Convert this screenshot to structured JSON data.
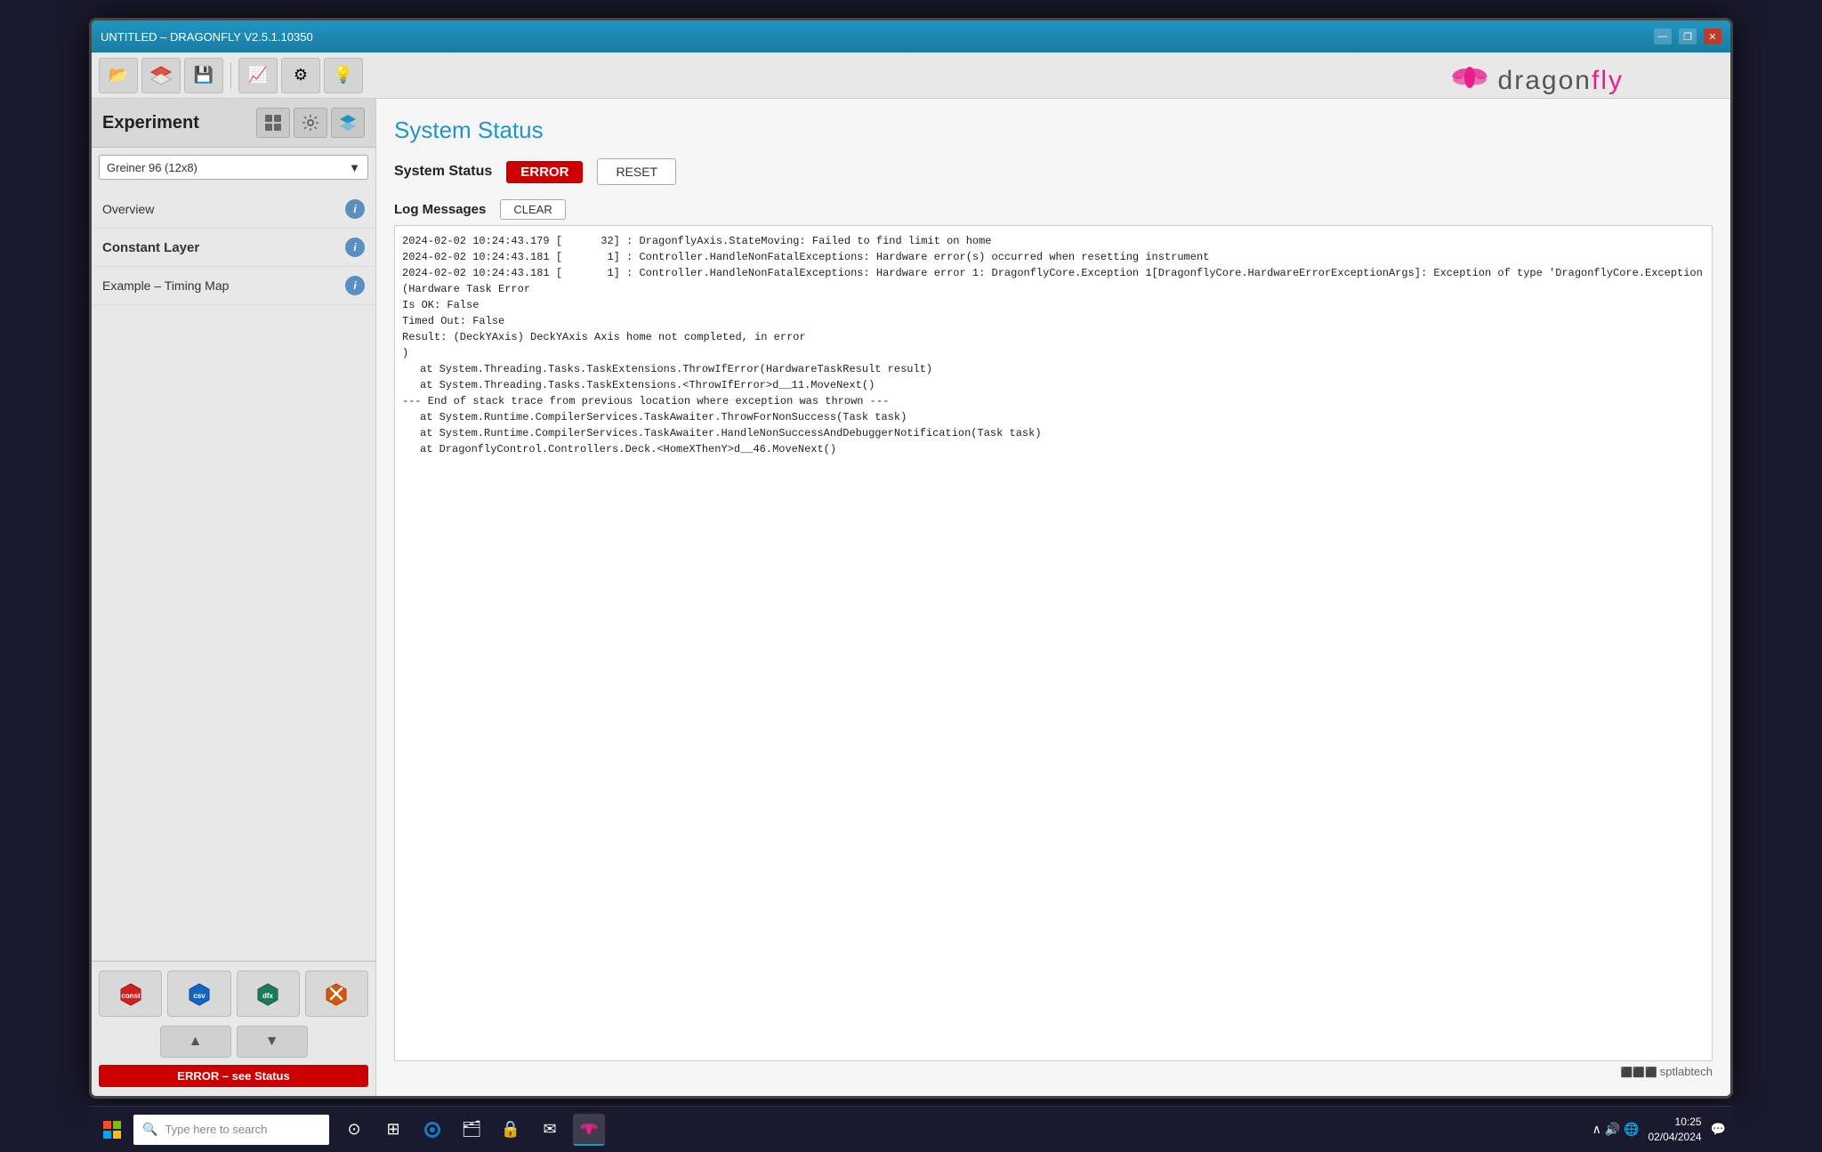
{
  "titleBar": {
    "title": "UNTITLED – DRAGONFLY V2.5.1.10350",
    "controls": [
      "—",
      "❐",
      "✕"
    ]
  },
  "toolbar": {
    "buttons": [
      {
        "name": "open",
        "icon": "📂"
      },
      {
        "name": "layers",
        "icon": "🔧"
      },
      {
        "name": "save",
        "icon": "💾"
      },
      {
        "name": "waveform",
        "icon": "📈"
      },
      {
        "name": "settings",
        "icon": "⚙"
      },
      {
        "name": "bulb",
        "icon": "💡"
      }
    ]
  },
  "sidebar": {
    "title": "Experiment",
    "headerIcons": [
      "⚙",
      "📊",
      "📋"
    ],
    "dropdown": {
      "value": "Greiner 96  (12x8)",
      "options": [
        "Greiner 96  (12x8)"
      ]
    },
    "navItems": [
      {
        "label": "Overview",
        "bold": false,
        "hasInfo": true
      },
      {
        "label": "Constant Layer",
        "bold": true,
        "hasInfo": true
      },
      {
        "label": "Example – Timing Map",
        "bold": false,
        "hasInfo": true
      }
    ],
    "toolIcons": [
      {
        "name": "const-icon",
        "label": "const",
        "color": "red"
      },
      {
        "name": "csv-icon",
        "label": "csv",
        "color": "blue"
      },
      {
        "name": "dfx-icon",
        "label": "dfx",
        "color": "teal"
      },
      {
        "name": "tools-icon",
        "label": "",
        "color": "orange"
      }
    ],
    "arrows": [
      "▲",
      "▼"
    ],
    "statusBar": "ERROR – see Status"
  },
  "content": {
    "pageTitle": "System Status",
    "systemStatus": {
      "label": "System Status",
      "badge": "ERROR",
      "resetLabel": "RESET"
    },
    "logSection": {
      "title": "Log Messages",
      "clearLabel": "CLEAR",
      "lines": [
        "2024-02-02 10:24:43.179 [      32] : DragonflyAxis.StateMoving: Failed to find limit on home",
        "2024-02-02 10:24:43.181 [       1] : Controller.HandleNonFatalExceptions: Hardware error(s) occurred when resetting instrument",
        "2024-02-02 10:24:43.181 [       1] : Controller.HandleNonFatalExceptions: Hardware error 1: DragonflyCore.Exception 1[DragonflyCore.HardwareErrorExceptionArgs]: Exception of type 'DragonflyCore.Exception",
        "(Hardware Task Error",
        "Is OK: False",
        "Timed Out: False",
        "Result: (DeckYAxis) DeckYAxis Axis home not completed, in error",
        ")",
        "   at System.Threading.Tasks.TaskExtensions.ThrowIfError(HardwareTaskResult result)",
        "   at System.Threading.Tasks.TaskExtensions.<ThrowIfError>d__11.MoveNext()",
        "--- End of stack trace from previous location where exception was thrown ---",
        "   at System.Runtime.CompilerServices.TaskAwaiter.ThrowForNonSuccess(Task task)",
        "   at System.Runtime.CompilerServices.TaskAwaiter.HandleNonSuccessAndDebuggerNotification(Task task)",
        "   at DragonflyControl.Controllers.Deck.<HomeXThenY>d__46.MoveNext()"
      ]
    }
  },
  "logo": {
    "text": "dragonfly",
    "iconSymbol": "✦"
  },
  "sptlab": "sptlabtech",
  "taskbar": {
    "searchPlaceholder": "Type here to search",
    "icons": [
      "⊙",
      "⊞",
      "e",
      "🗂",
      "🔒",
      "✉",
      "🐉"
    ],
    "time": "10:25",
    "date": "02/04/2024"
  }
}
